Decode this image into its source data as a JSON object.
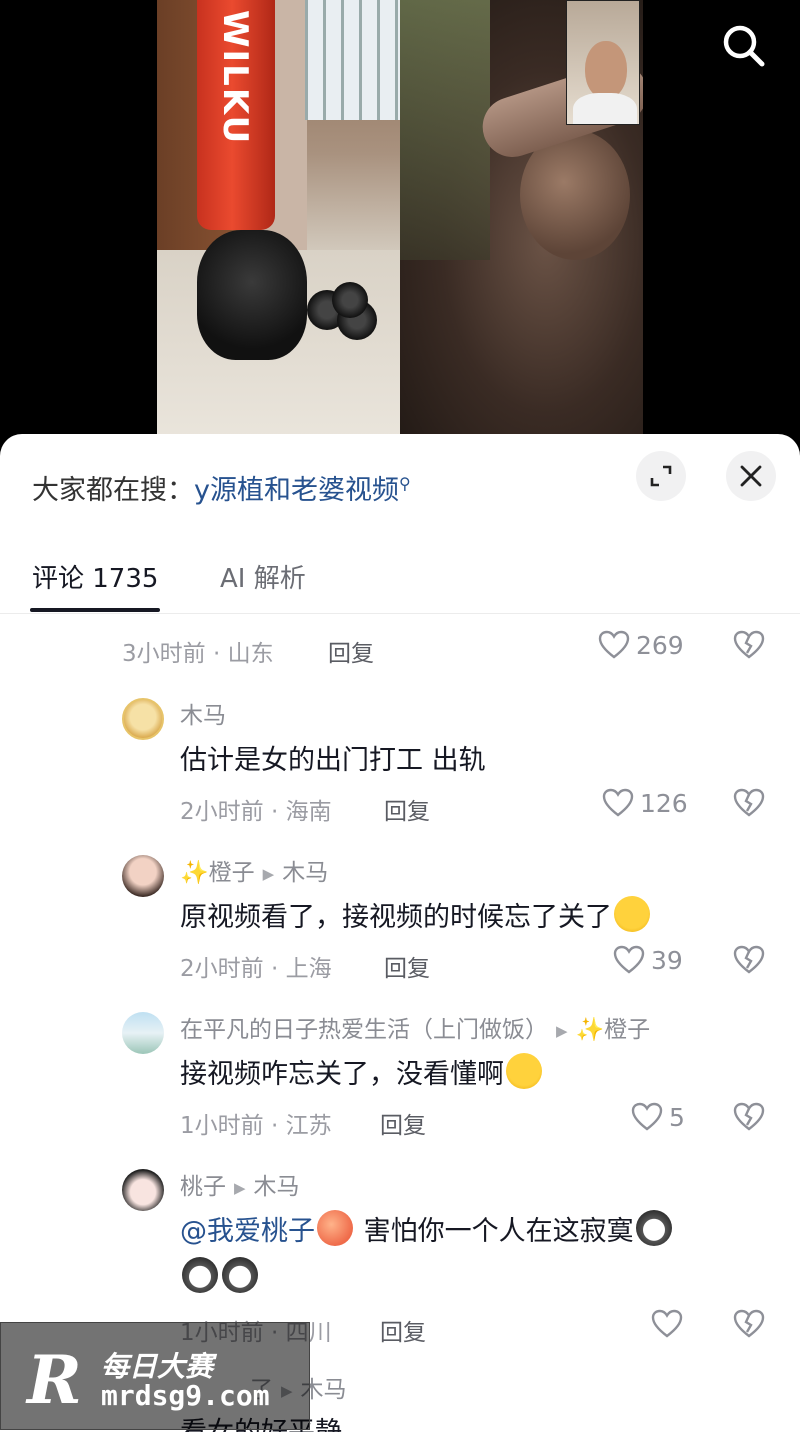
{
  "video": {
    "bag_brand": "WILKU"
  },
  "suggest": {
    "prefix": "大家都在搜：",
    "term": "y源植和老婆视频"
  },
  "tabs": {
    "comments": "评论 1735",
    "ai": "AI 解析"
  },
  "comments": [
    {
      "time": "3小时前 · 山东",
      "reply": "回复",
      "likes": "269"
    },
    {
      "author": "木马",
      "text": "估计是女的出门打工 出轨",
      "time": "2小时前 · 海南",
      "reply": "回复",
      "likes": "126"
    },
    {
      "author": "✨橙子",
      "reply_to": "木马",
      "text": "原视频看了，接视频的时候忘了关了",
      "time": "2小时前 · 上海",
      "reply": "回复",
      "likes": "39"
    },
    {
      "author": "在平凡的日子热爱生活（上门做饭）",
      "reply_to": "✨橙子",
      "text": "接视频咋忘关了，没看懂啊",
      "time": "1小时前 · 江苏",
      "reply": "回复",
      "likes": "5"
    },
    {
      "author": "桃子",
      "reply_to": "木马",
      "mention": "@我爱桃子",
      "text": " 害怕你一个人在这寂寞",
      "time": "1小时前 · 四川",
      "reply": "回复",
      "likes": ""
    },
    {
      "author": "了",
      "reply_to": "木马",
      "text": "看女的好平静"
    }
  ],
  "watermark": {
    "logo": "R",
    "name": "每日大赛",
    "url": "mrdsg9.com"
  },
  "colors": {
    "accent_link": "#27528f",
    "text_primary": "#161823",
    "text_secondary": "#9b9ca3"
  }
}
